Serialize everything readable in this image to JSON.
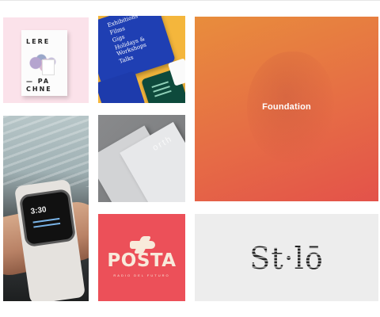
{
  "gallery": {
    "tiles": [
      {
        "id": "lere-pachne",
        "book_lines": [
          "LERE",
          "— PA",
          "CHNE"
        ],
        "background": "#fbe2ea"
      },
      {
        "id": "tablets-events",
        "tablet_lines": [
          "Exhibitions",
          "Films",
          "Gigs",
          "Holidays & Workshops",
          "Talks"
        ],
        "background": "#f4b63c"
      },
      {
        "id": "foundation",
        "label": "Foundation",
        "gradient": [
          "#e88d3c",
          "#e3524a"
        ]
      },
      {
        "id": "watch",
        "watch_time": "3:30"
      },
      {
        "id": "stationery",
        "paper_text": "orth"
      },
      {
        "id": "posta",
        "title": "POSTA",
        "subtitle": "RADIO DEL FUTURO",
        "background": "#ec5059"
      },
      {
        "id": "st-lo",
        "logo": "St·lō",
        "background": "#ededed"
      }
    ]
  }
}
